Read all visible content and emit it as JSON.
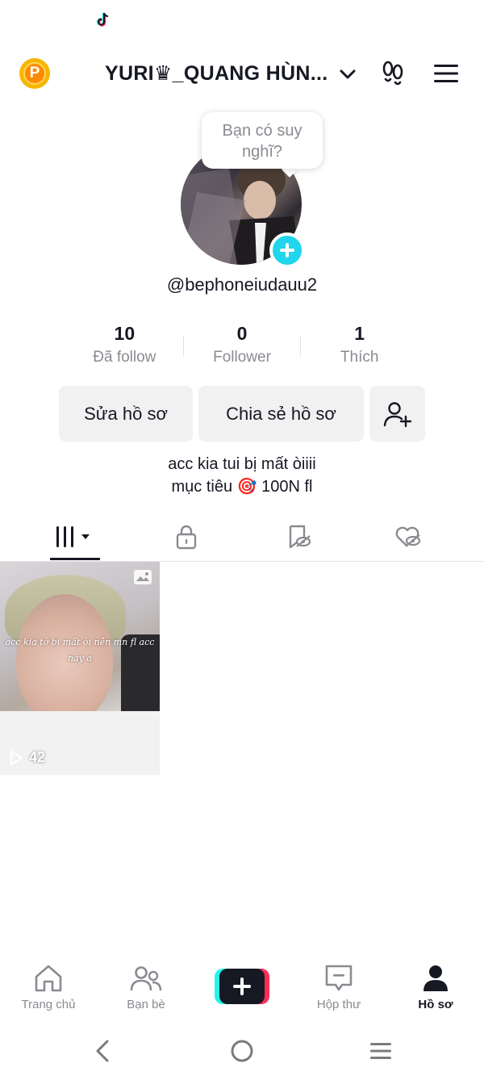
{
  "top_bar": {
    "title": "YURI♛_QUANG HÙN...",
    "points_letter": "P"
  },
  "profile": {
    "thought": "Bạn có suy nghĩ?",
    "handle": "@bephoneiudauu2"
  },
  "stats": [
    {
      "value": "10",
      "label": "Đã follow"
    },
    {
      "value": "0",
      "label": "Follower"
    },
    {
      "value": "1",
      "label": "Thích"
    }
  ],
  "actions": {
    "edit": "Sửa hồ sơ",
    "share": "Chia sẻ hồ sơ"
  },
  "bio": {
    "line1": "acc kia tui bị mất òiiii",
    "line2": "mục tiêu 🎯 100N fl"
  },
  "tabs": [
    "videos",
    "private",
    "reposts",
    "liked"
  ],
  "videos": [
    {
      "caption_line1": "acc kia tớ bị mất òi nên mn fl acc",
      "caption_line2": "này a",
      "views": "42"
    }
  ],
  "bottom_nav": {
    "home": "Trang chủ",
    "friends": "Bạn bè",
    "inbox": "Hộp thư",
    "profile": "Hồ sơ"
  },
  "colors": {
    "accent_cyan": "#20d5ec",
    "brand_red": "#fe2c55",
    "brand_aqua": "#25f4ee",
    "text_primary": "#161823",
    "text_secondary": "#8a8b91"
  }
}
